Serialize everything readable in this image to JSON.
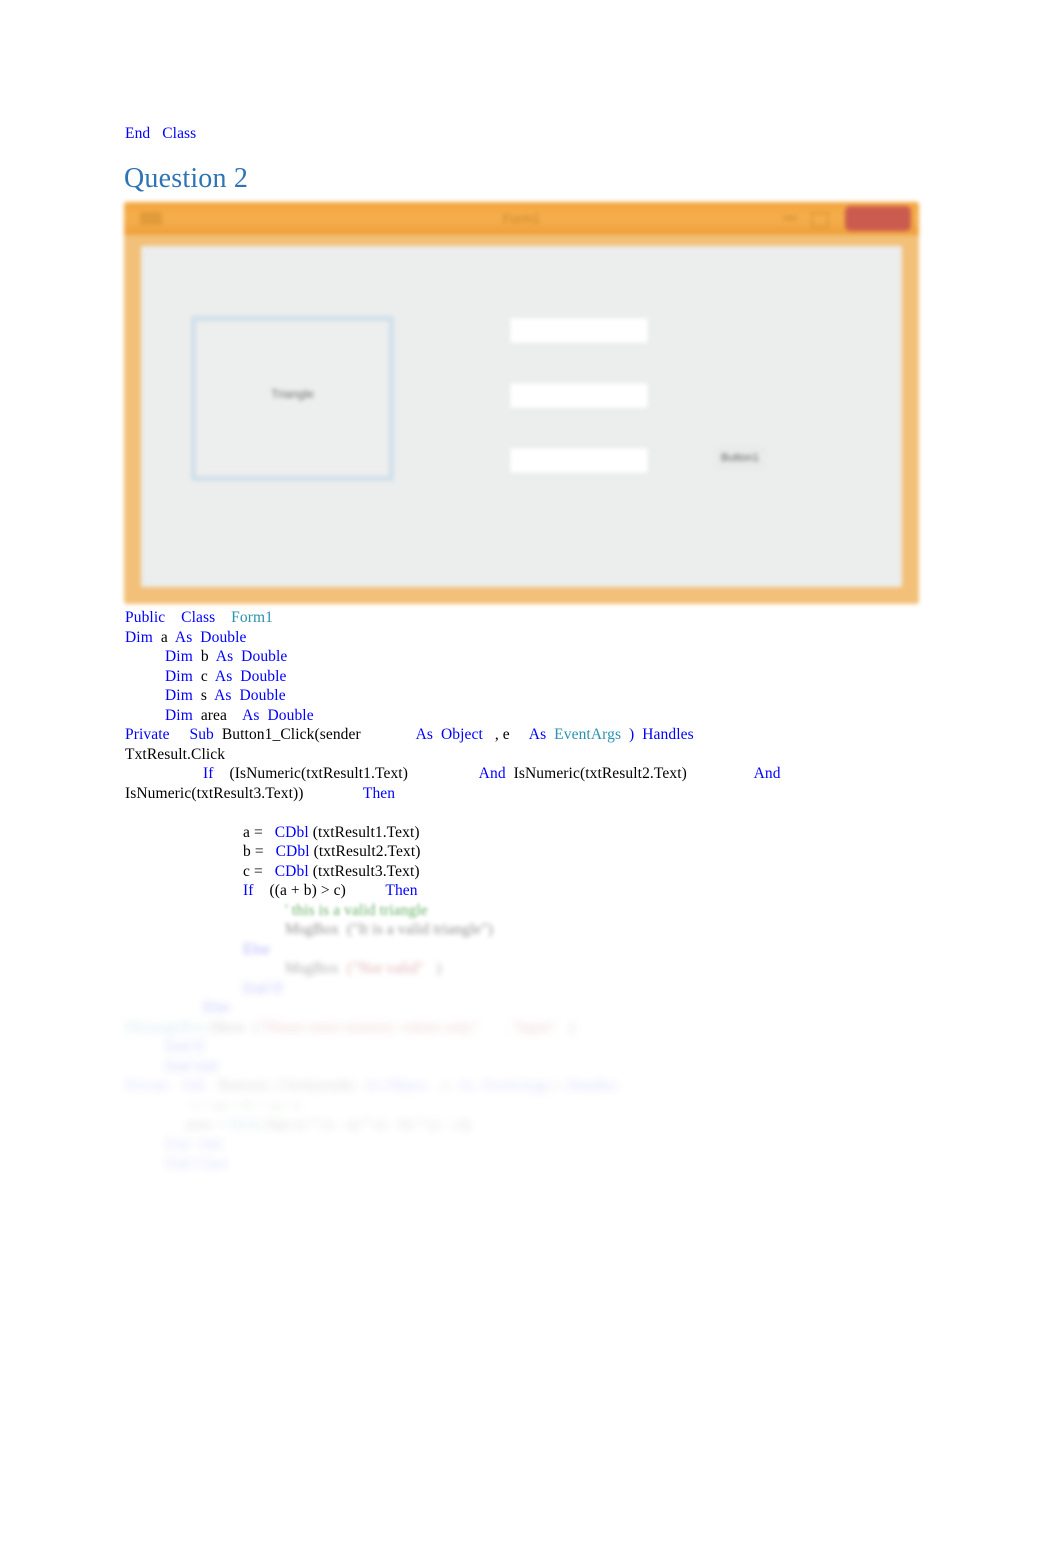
{
  "document": {
    "background_color": "#ffffff",
    "end_class_line": {
      "keyword_end": "End",
      "keyword_class": "Class"
    },
    "heading": "Question 2"
  },
  "colors": {
    "heading_blue": "#2E74B5",
    "vb_keyword_blue": "#0000FF",
    "vb_type_teal": "#2B91AF",
    "vb_string_red": "#A31515",
    "vb_comment_green": "#008000",
    "form_border_orange": "#F2C078",
    "form_titlebar_orange": "#F4A63E",
    "form_close_red": "#CB5B4E",
    "form_client_gray": "#ECEDED",
    "panel_border_blue": "#CFE0EA"
  },
  "form_screenshot": {
    "title": "Form1",
    "menu_icon": "hamburger-icon",
    "minimize_icon": "minimize-icon",
    "maximize_icon": "maximize-icon",
    "close_label": "Close",
    "picture_panel_label": "Triangle",
    "textboxes": [
      {
        "name": "txtResult1",
        "value": ""
      },
      {
        "name": "txtResult2",
        "value": ""
      },
      {
        "name": "txtResult3",
        "value": ""
      }
    ],
    "button_label": "Button1"
  },
  "code": {
    "lines": [
      {
        "id": "line-public-class",
        "indent": 0,
        "fade": "",
        "tokens": [
          {
            "t": "Public",
            "c": "kw"
          },
          {
            "t": "    ",
            "c": ""
          },
          {
            "t": "Class",
            "c": "kw"
          },
          {
            "t": "    ",
            "c": ""
          },
          {
            "t": "Form1",
            "c": "typ"
          }
        ]
      },
      {
        "id": "line-dim-a",
        "indent": 0,
        "fade": "",
        "tokens": [
          {
            "t": "Dim",
            "c": "kw"
          },
          {
            "t": "  ",
            "c": ""
          },
          {
            "t": "a",
            "c": ""
          },
          {
            "t": "  ",
            "c": ""
          },
          {
            "t": "As",
            "c": "kw"
          },
          {
            "t": "  ",
            "c": ""
          },
          {
            "t": "Double",
            "c": "kw"
          }
        ]
      },
      {
        "id": "line-dim-b",
        "indent": 40,
        "fade": "",
        "tokens": [
          {
            "t": "Dim",
            "c": "kw"
          },
          {
            "t": "  ",
            "c": ""
          },
          {
            "t": "b",
            "c": ""
          },
          {
            "t": "  ",
            "c": ""
          },
          {
            "t": "As",
            "c": "kw"
          },
          {
            "t": "  ",
            "c": ""
          },
          {
            "t": "Double",
            "c": "kw"
          }
        ]
      },
      {
        "id": "line-dim-c",
        "indent": 40,
        "fade": "",
        "tokens": [
          {
            "t": "Dim",
            "c": "kw"
          },
          {
            "t": "  ",
            "c": ""
          },
          {
            "t": "c",
            "c": ""
          },
          {
            "t": "  ",
            "c": ""
          },
          {
            "t": "As",
            "c": "kw"
          },
          {
            "t": "  ",
            "c": ""
          },
          {
            "t": "Double",
            "c": "kw"
          }
        ]
      },
      {
        "id": "line-dim-s",
        "indent": 40,
        "fade": "",
        "tokens": [
          {
            "t": "Dim",
            "c": "kw"
          },
          {
            "t": "  ",
            "c": ""
          },
          {
            "t": "s",
            "c": ""
          },
          {
            "t": "  ",
            "c": ""
          },
          {
            "t": "As",
            "c": "kw"
          },
          {
            "t": "  ",
            "c": ""
          },
          {
            "t": "Double",
            "c": "kw"
          }
        ]
      },
      {
        "id": "line-dim-area",
        "indent": 40,
        "fade": "",
        "tokens": [
          {
            "t": "Dim",
            "c": "kw"
          },
          {
            "t": "  ",
            "c": ""
          },
          {
            "t": "area",
            "c": ""
          },
          {
            "t": "    ",
            "c": ""
          },
          {
            "t": "As",
            "c": "kw"
          },
          {
            "t": "  ",
            "c": ""
          },
          {
            "t": "Double",
            "c": "kw"
          }
        ]
      },
      {
        "id": "line-private-sub",
        "indent": 0,
        "fade": "",
        "tokens": [
          {
            "t": "Private",
            "c": "kw"
          },
          {
            "t": "     ",
            "c": ""
          },
          {
            "t": "Sub",
            "c": "kw"
          },
          {
            "t": "  ",
            "c": ""
          },
          {
            "t": "Button1_Click(sender",
            "c": ""
          },
          {
            "t": "              ",
            "c": ""
          },
          {
            "t": "As",
            "c": "kw"
          },
          {
            "t": "  ",
            "c": ""
          },
          {
            "t": "Object",
            "c": "kw"
          },
          {
            "t": "   ",
            "c": ""
          },
          {
            "t": ", e",
            "c": ""
          },
          {
            "t": "     ",
            "c": ""
          },
          {
            "t": "As",
            "c": "kw"
          },
          {
            "t": "  ",
            "c": ""
          },
          {
            "t": "EventArgs",
            "c": "typ"
          },
          {
            "t": "  ",
            "c": ""
          },
          {
            "t": ")",
            "c": "kw"
          },
          {
            "t": "  ",
            "c": ""
          },
          {
            "t": "Handles",
            "c": "kw"
          }
        ]
      },
      {
        "id": "line-txtresult-click",
        "indent": 0,
        "fade": "",
        "tokens": [
          {
            "t": "TxtResult.Click",
            "c": ""
          }
        ]
      },
      {
        "id": "line-if-isnumeric",
        "indent": 78,
        "fade": "",
        "tokens": [
          {
            "t": "If",
            "c": "kw"
          },
          {
            "t": "    ",
            "c": ""
          },
          {
            "t": "(IsNumeric(txtResult1.Text)",
            "c": ""
          },
          {
            "t": "                  ",
            "c": ""
          },
          {
            "t": "And",
            "c": "kw"
          },
          {
            "t": "  ",
            "c": ""
          },
          {
            "t": "IsNumeric(txtResult2.Text)",
            "c": ""
          },
          {
            "t": "                 ",
            "c": ""
          },
          {
            "t": "And",
            "c": "kw"
          }
        ]
      },
      {
        "id": "line-isnumeric3-then",
        "indent": 0,
        "fade": "",
        "tokens": [
          {
            "t": "IsNumeric(txtResult3.Text))",
            "c": ""
          },
          {
            "t": "               ",
            "c": ""
          },
          {
            "t": "Then",
            "c": "kw"
          }
        ]
      },
      {
        "id": "line-blank-1",
        "indent": 0,
        "fade": "",
        "tokens": [
          {
            "t": " ",
            "c": ""
          }
        ]
      },
      {
        "id": "line-a-assign",
        "indent": 118,
        "fade": "",
        "tokens": [
          {
            "t": "a =",
            "c": ""
          },
          {
            "t": "   ",
            "c": ""
          },
          {
            "t": "CDbl",
            "c": "kw"
          },
          {
            "t": " ",
            "c": ""
          },
          {
            "t": "(txtResult1.Text)",
            "c": ""
          }
        ]
      },
      {
        "id": "line-b-assign",
        "indent": 118,
        "fade": "",
        "tokens": [
          {
            "t": "b =",
            "c": ""
          },
          {
            "t": "   ",
            "c": ""
          },
          {
            "t": "CDbl",
            "c": "kw"
          },
          {
            "t": " ",
            "c": ""
          },
          {
            "t": "(txtResult2.Text)",
            "c": ""
          }
        ]
      },
      {
        "id": "line-c-assign",
        "indent": 118,
        "fade": "",
        "tokens": [
          {
            "t": "c =",
            "c": ""
          },
          {
            "t": "   ",
            "c": ""
          },
          {
            "t": "CDbl",
            "c": "kw"
          },
          {
            "t": " ",
            "c": ""
          },
          {
            "t": "(txtResult3.Text)",
            "c": ""
          }
        ]
      },
      {
        "id": "line-if-sum",
        "indent": 118,
        "fade": "",
        "tokens": [
          {
            "t": "If",
            "c": "kw"
          },
          {
            "t": "    ",
            "c": ""
          },
          {
            "t": "((a + b) > c)",
            "c": ""
          },
          {
            "t": "          ",
            "c": ""
          },
          {
            "t": "Then",
            "c": "kw"
          }
        ]
      },
      {
        "id": "line-comment-valid",
        "indent": 160,
        "fade": "fade-1",
        "tokens": [
          {
            "t": "' this is a valid triangle",
            "c": "cmt"
          }
        ]
      },
      {
        "id": "line-msgbox-valid",
        "indent": 160,
        "fade": "fade-2",
        "tokens": [
          {
            "t": "MsgBox",
            "c": ""
          },
          {
            "t": "  ",
            "c": ""
          },
          {
            "t": "(\"It is a valid triangle\")",
            "c": ""
          }
        ]
      },
      {
        "id": "line-else-1",
        "indent": 118,
        "fade": "fade-3",
        "tokens": [
          {
            "t": "Else",
            "c": "kw"
          }
        ]
      },
      {
        "id": "line-msgbox-invalid",
        "indent": 160,
        "fade": "fade-3",
        "tokens": [
          {
            "t": "MsgBox",
            "c": ""
          },
          {
            "t": "  ",
            "c": ""
          },
          {
            "t": "(\"Not valid\"",
            "c": "str"
          },
          {
            "t": "   ",
            "c": ""
          },
          {
            "t": ")",
            "c": ""
          }
        ]
      },
      {
        "id": "line-endif-1",
        "indent": 118,
        "fade": "fade-4",
        "tokens": [
          {
            "t": "End If",
            "c": "kw"
          }
        ]
      },
      {
        "id": "line-else-2",
        "indent": 78,
        "fade": "fade-4",
        "tokens": [
          {
            "t": "Else",
            "c": "kw"
          }
        ]
      },
      {
        "id": "line-msgbox-numeric",
        "indent": 0,
        "fade": "fade-5",
        "tokens": [
          {
            "t": "MessageBox",
            "c": "typ"
          },
          {
            "t": ".",
            "c": ""
          },
          {
            "t": "Show",
            "c": ""
          },
          {
            "t": "  ",
            "c": ""
          },
          {
            "t": "(",
            "c": ""
          },
          {
            "t": "\"Please enter numeric values only\"",
            "c": "str"
          },
          {
            "t": "      ",
            "c": ""
          },
          {
            "t": ", \"Input\"",
            "c": "str"
          },
          {
            "t": "   ",
            "c": ""
          },
          {
            "t": ")",
            "c": ""
          }
        ]
      },
      {
        "id": "line-endif-2",
        "indent": 40,
        "fade": "fade-5",
        "tokens": [
          {
            "t": "End If",
            "c": "kw"
          }
        ]
      },
      {
        "id": "line-end-sub-1",
        "indent": 40,
        "fade": "fade-5",
        "tokens": [
          {
            "t": "End",
            "c": "kw"
          },
          {
            "t": " ",
            "c": ""
          },
          {
            "t": "Sub",
            "c": "kw"
          }
        ]
      },
      {
        "id": "line-private-sub-2",
        "indent": 0,
        "fade": "fade-6",
        "tokens": [
          {
            "t": "Private",
            "c": "kw"
          },
          {
            "t": "   ",
            "c": ""
          },
          {
            "t": "Sub",
            "c": "kw"
          },
          {
            "t": "   ",
            "c": ""
          },
          {
            "t": "Button2_Click(sender",
            "c": ""
          },
          {
            "t": "  ",
            "c": ""
          },
          {
            "t": "As",
            "c": "kw"
          },
          {
            "t": " ",
            "c": ""
          },
          {
            "t": "Object",
            "c": "kw"
          },
          {
            "t": "  , ",
            "c": ""
          },
          {
            "t": "e",
            "c": ""
          },
          {
            "t": "  ",
            "c": ""
          },
          {
            "t": "As",
            "c": "kw"
          },
          {
            "t": "  ",
            "c": ""
          },
          {
            "t": "EventArgs",
            "c": "kw"
          },
          {
            "t": " )  ",
            "c": ""
          },
          {
            "t": "Handles",
            "c": "kw"
          }
        ]
      },
      {
        "id": "line-comment-heron",
        "indent": 60,
        "fade": "fade-6",
        "tokens": [
          {
            "t": "' s = (a + b + c) / 2",
            "c": "cmt"
          }
        ]
      },
      {
        "id": "line-area-formula",
        "indent": 60,
        "fade": "fade-6",
        "tokens": [
          {
            "t": "area",
            "c": ""
          },
          {
            "t": " = ",
            "c": ""
          },
          {
            "t": "Math",
            "c": "typ"
          },
          {
            "t": ".Sqrt (s * (s - a) * (s - b) * (s - c))",
            "c": ""
          }
        ]
      },
      {
        "id": "line-endsub-2",
        "indent": 40,
        "fade": "fade-6",
        "tokens": [
          {
            "t": "End",
            "c": "kw"
          },
          {
            "t": "  ",
            "c": ""
          },
          {
            "t": "Sub",
            "c": "kw"
          }
        ]
      },
      {
        "id": "line-end-class-2",
        "indent": 40,
        "fade": "fade-6",
        "tokens": [
          {
            "t": "End",
            "c": "kw"
          },
          {
            "t": " ",
            "c": ""
          },
          {
            "t": "Class",
            "c": "kw"
          }
        ]
      }
    ]
  }
}
